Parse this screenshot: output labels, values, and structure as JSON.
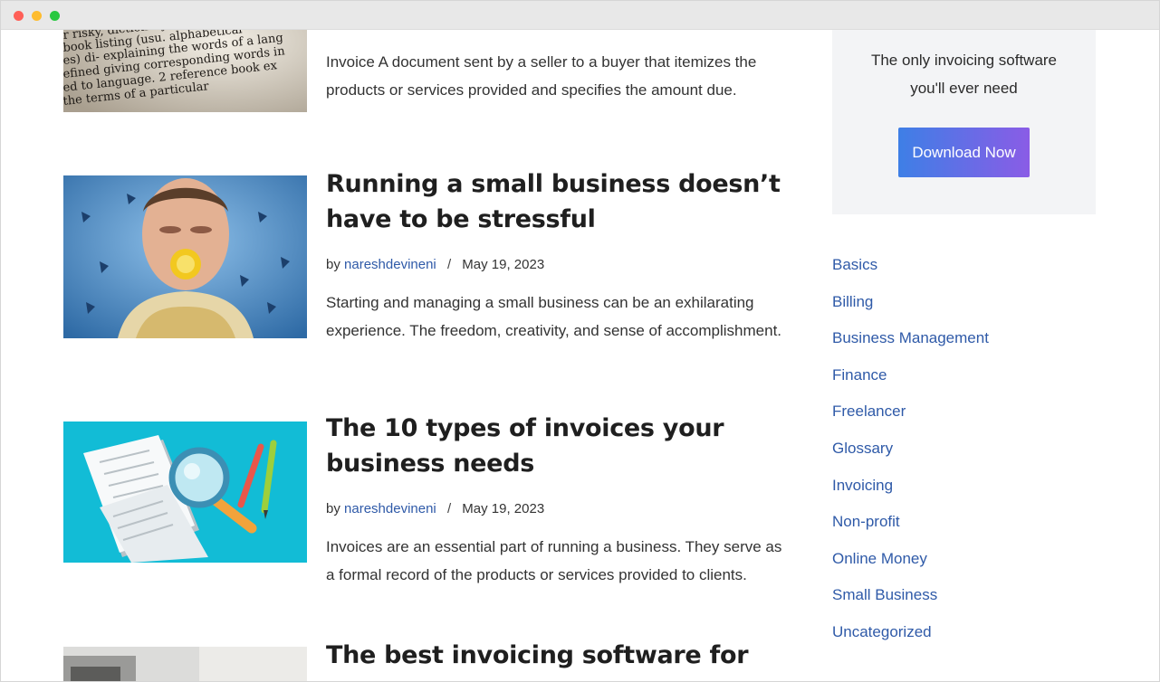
{
  "posts": [
    {
      "title": "",
      "excerpt": "Invoice A document sent by a seller to a buyer that itemizes the products or services provided and specifies the amount due.",
      "image": "dictionary-page-photo"
    },
    {
      "title": "Running a small business doesn’t have to be stressful",
      "author": "nareshdevineni",
      "separator": "/",
      "date": "May 19, 2023",
      "excerpt": "Starting and managing a small business can be an exhilarating experience. The freedom, creativity, and sense of accomplishment.",
      "image": "stressed-man-biting-lemon-photo"
    },
    {
      "title": "The 10 types of invoices your business needs",
      "author": "nareshdevineni",
      "separator": "/",
      "date": "May 19, 2023",
      "excerpt": "Invoices are an essential part of running a business. They serve as a formal record of the products or services provided to clients.",
      "image": "documents-magnifier-illustration"
    },
    {
      "title": "The best invoicing software for",
      "image": "calculator-photo"
    }
  ],
  "by_label": "by",
  "sidebar": {
    "promo_text": "The only invoicing software you'll ever need",
    "button_label": "Download Now",
    "categories": [
      "Basics",
      "Billing",
      "Business Management",
      "Finance",
      "Freelancer",
      "Glossary",
      "Invoicing",
      "Non-profit",
      "Online Money",
      "Small Business",
      "Uncategorized"
    ]
  },
  "colors": {
    "link": "#2f5aa8",
    "button_gradient_start": "#3e7fe6",
    "button_gradient_end": "#8a5ce6",
    "promo_bg": "#f3f4f6"
  }
}
